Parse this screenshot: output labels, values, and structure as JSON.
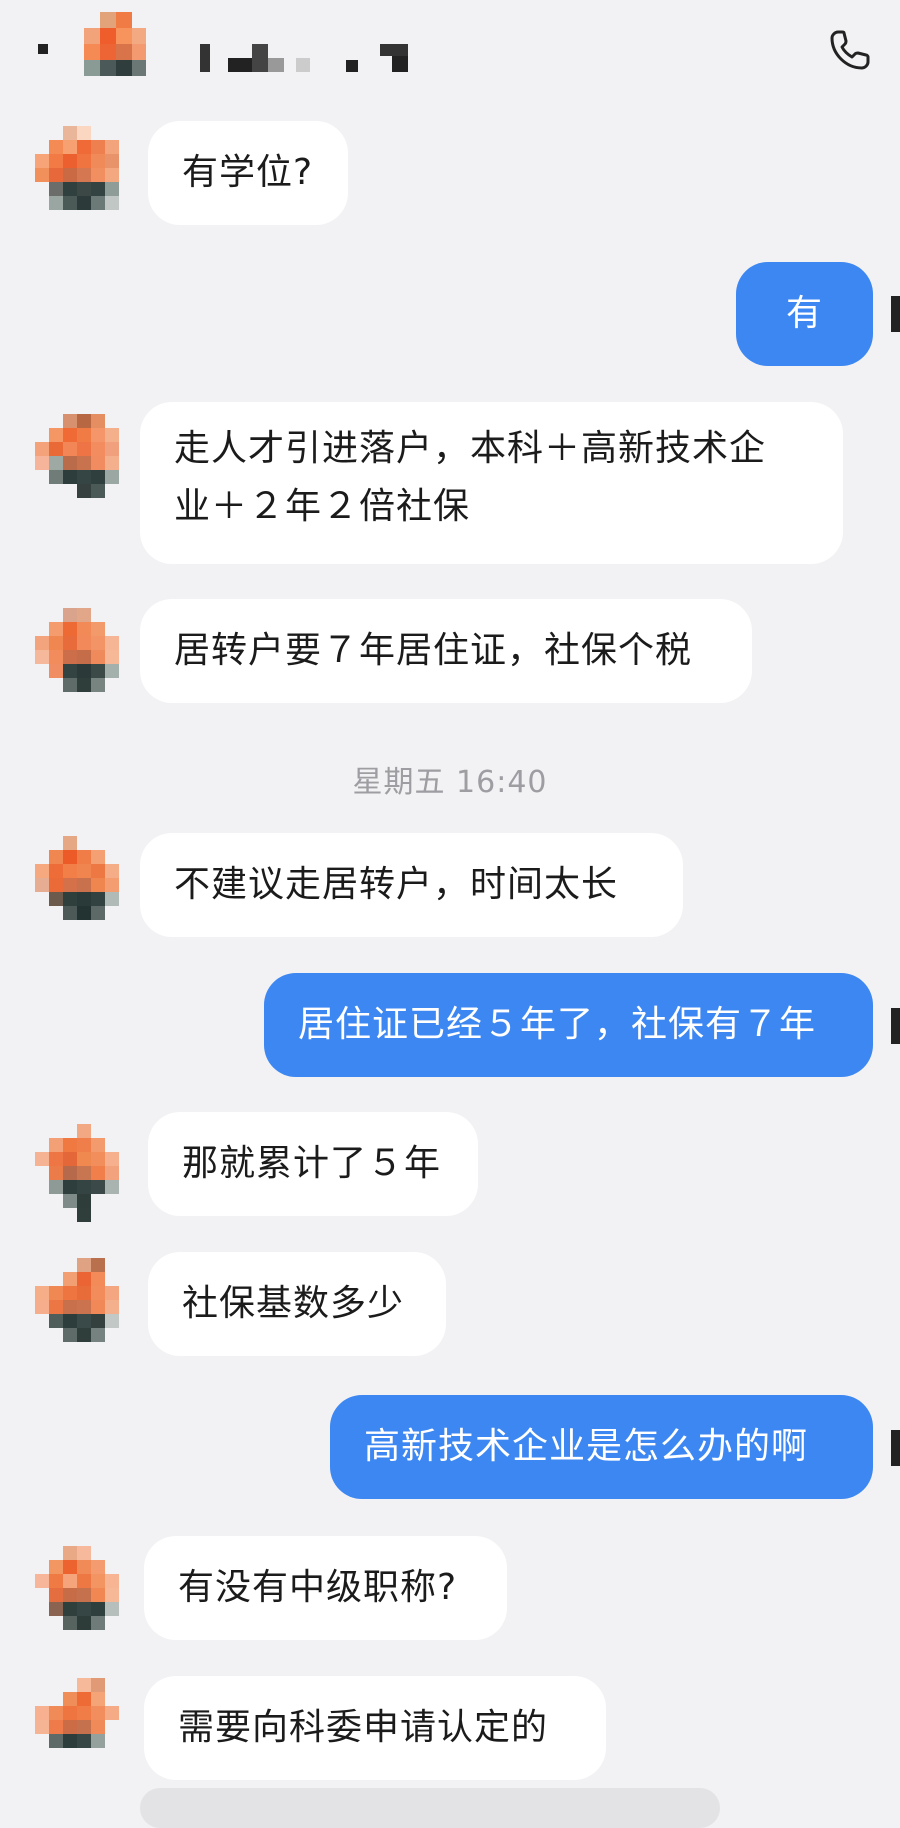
{
  "header": {
    "call_icon": "phone-icon",
    "contact_name_state": "pixelated"
  },
  "messages": [
    {
      "from": "contact",
      "lines": [
        "有学位?"
      ]
    },
    {
      "from": "me",
      "lines": [
        "有"
      ]
    },
    {
      "from": "contact",
      "lines": [
        "走人才引进落户，本科＋高新技术企",
        "业＋２年２倍社保"
      ]
    },
    {
      "from": "contact",
      "lines": [
        "居转户要７年居住证，社保个税"
      ]
    },
    {
      "from": "contact",
      "lines": [
        "不建议走居转户，时间太长"
      ]
    },
    {
      "from": "me",
      "lines": [
        "居住证已经５年了，社保有７年"
      ]
    },
    {
      "from": "contact",
      "lines": [
        "那就累计了５年"
      ]
    },
    {
      "from": "contact",
      "lines": [
        "社保基数多少"
      ]
    },
    {
      "from": "me",
      "lines": [
        "高新技术企业是怎么办的啊"
      ]
    },
    {
      "from": "contact",
      "lines": [
        "有没有中级职称?"
      ]
    },
    {
      "from": "contact",
      "lines": [
        "需要向科委申请认定的"
      ]
    }
  ],
  "timestamp": "星期五 16:40",
  "colors": {
    "background": "#f2f2f4",
    "incoming_bubble": "#ffffff",
    "outgoing_bubble": "#3d87f2",
    "timestamp_text": "#9d9da2"
  }
}
